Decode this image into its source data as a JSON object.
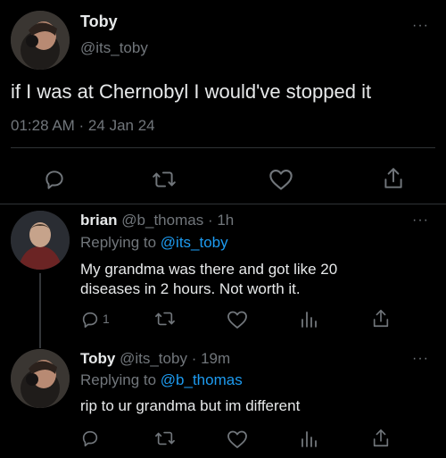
{
  "main_tweet": {
    "author": {
      "name": "Toby",
      "handle": "@its_toby"
    },
    "text": "if I was at Chernobyl I would've stopped it",
    "timestamp": "01:28 AM · 24 Jan 24",
    "actions": [
      "reply-icon",
      "retweet-icon",
      "like-icon",
      "share-icon"
    ]
  },
  "replies": [
    {
      "name": "brian",
      "handle": "@b_thomas",
      "time": "· 1h",
      "replying_prefix": "Replying to",
      "replying_to": "@its_toby",
      "text_line1": "My grandma was there and got like 20",
      "text_line2": "diseases in 2 hours. Not worth it.",
      "reply_count": "1"
    },
    {
      "name": "Toby",
      "handle": "@its_toby",
      "time": "· 19m",
      "replying_prefix": "Replying to",
      "replying_to": "@b_thomas",
      "text_line1": "rip to ur grandma but im different"
    }
  ],
  "more_glyph": "···",
  "colors": {
    "background": "#000000",
    "text": "#e7e9ea",
    "muted": "#71767b",
    "link": "#1d9bf0",
    "divider": "#2f3336"
  }
}
